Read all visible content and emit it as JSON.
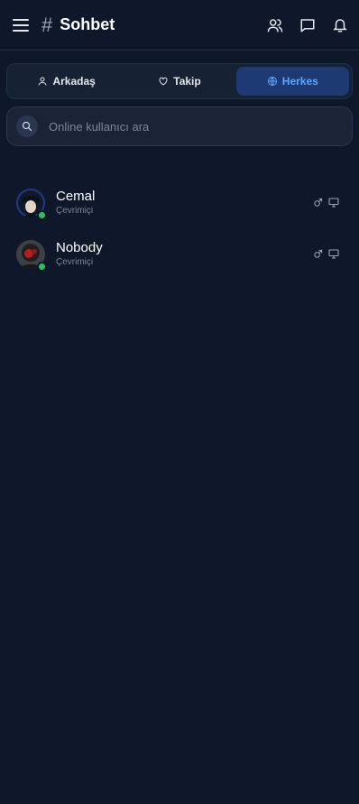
{
  "header": {
    "title": "Sohbet",
    "hash_symbol": "#"
  },
  "tabs": [
    {
      "label": "Arkadaş",
      "icon": "user-icon",
      "active": false
    },
    {
      "label": "Takip",
      "icon": "heart-icon",
      "active": false
    },
    {
      "label": "Herkes",
      "icon": "globe-icon",
      "active": true
    }
  ],
  "search": {
    "placeholder": "Online kullanıcı ara",
    "value": ""
  },
  "users": [
    {
      "name": "Cemal",
      "status": "Çevrimiçi",
      "gender_icon": "male-icon",
      "device_icon": "desktop-icon"
    },
    {
      "name": "Nobody",
      "status": "Çevrimiçi",
      "gender_icon": "male-icon",
      "device_icon": "desktop-icon"
    }
  ],
  "colors": {
    "background": "#0f172a",
    "active_tab_bg": "#1e3a73",
    "active_tab_text": "#5fa5ff",
    "online": "#22c55e"
  }
}
